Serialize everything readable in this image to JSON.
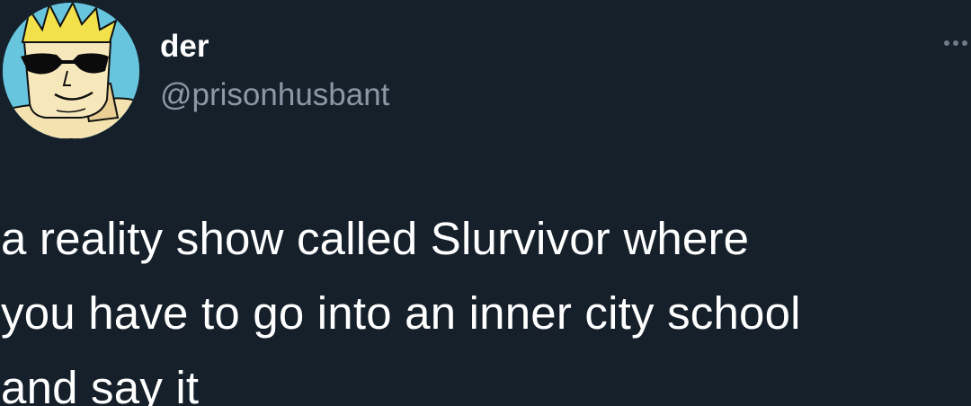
{
  "author": {
    "display_name": "der",
    "handle": "@prisonhusbant",
    "avatar_icon": "cartoon-character-with-sunglasses-avatar"
  },
  "menu": {
    "icon": "more-options-icon"
  },
  "tweet": {
    "lines": [
      "a reality show called Slurvivor where",
      "you have to go into an inner city school",
      "and say it"
    ]
  },
  "colors": {
    "background": "#15202b",
    "text": "#ffffff",
    "handle": "#8b98a5",
    "avatar_bg": "#67c6de"
  }
}
